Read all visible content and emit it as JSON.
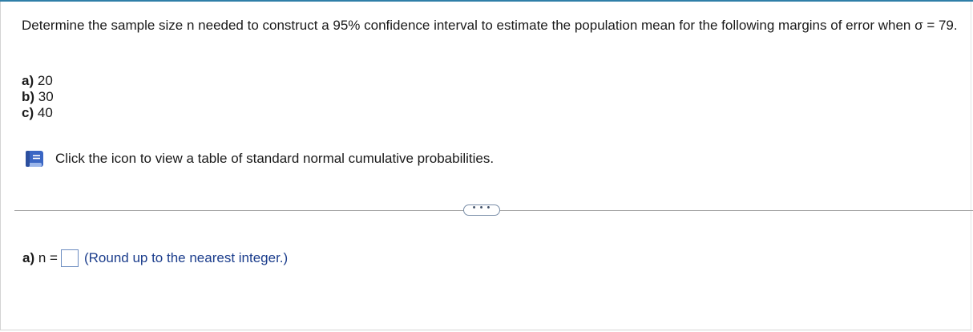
{
  "question": {
    "text": "Determine the sample size n needed to construct a 95% confidence interval to estimate the population mean for the following margins of error when σ = 79."
  },
  "parts": [
    {
      "label": "a)",
      "value": "20"
    },
    {
      "label": "b)",
      "value": "30"
    },
    {
      "label": "c)",
      "value": "40"
    }
  ],
  "resource": {
    "icon": "book-icon",
    "text": "Click the icon to view a table of standard normal cumulative probabilities."
  },
  "more_button": {
    "icon": "ellipsis-icon",
    "label": "• • •"
  },
  "answer": {
    "label": "a)",
    "variable": "n =",
    "value": "",
    "hint": "(Round up to the nearest integer.)"
  },
  "colors": {
    "top_bar": "#2f7fa8",
    "book_icon": "#3a66c4",
    "hint_text": "#1b3d8c",
    "input_border": "#6b8cc0"
  }
}
